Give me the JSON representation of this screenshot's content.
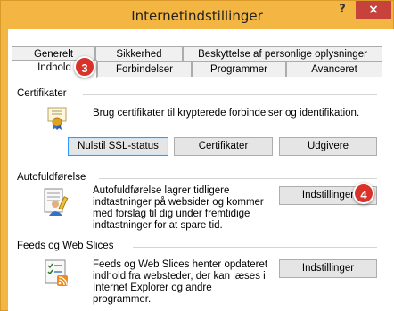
{
  "window": {
    "title": "Internetindstillinger",
    "help_label": "?",
    "close_label": "×"
  },
  "tabs": {
    "row1": [
      {
        "label": "Generelt"
      },
      {
        "label": "Sikkerhed"
      },
      {
        "label": "Beskyttelse af personlige oplysninger"
      }
    ],
    "row2": [
      {
        "label": "Indhold"
      },
      {
        "label": "Forbindelser"
      },
      {
        "label": "Programmer"
      },
      {
        "label": "Avanceret"
      }
    ]
  },
  "badges": {
    "tab_step": "3",
    "settings_step": "4"
  },
  "certificates": {
    "title": "Certifikater",
    "description": "Brug certifikater til krypterede forbindelser og identifikation.",
    "buttons": {
      "clear_ssl": "Nulstil SSL-status",
      "certificates": "Certifikater",
      "publishers": "Udgivere"
    }
  },
  "autocomplete": {
    "title": "Autofuldførelse",
    "description_lines": [
      "Autofuldførelse lagrer tidligere",
      "indtastninger på websider og kommer",
      "med forslag til dig under fremtidige",
      "indtastninger for at spare tid."
    ],
    "settings_button": "Indstillinger"
  },
  "feeds": {
    "title": "Feeds og Web Slices",
    "description_lines": [
      "Feeds og Web Slices henter opdateret",
      "indhold fra websteder, der kan læses i",
      "Internet Explorer og andre",
      "programmer."
    ],
    "settings_button": "Indstillinger"
  },
  "colors": {
    "titlebar": "#f4b642",
    "close": "#c7423a",
    "badge": "#d9322a",
    "focus": "#3399ff"
  }
}
